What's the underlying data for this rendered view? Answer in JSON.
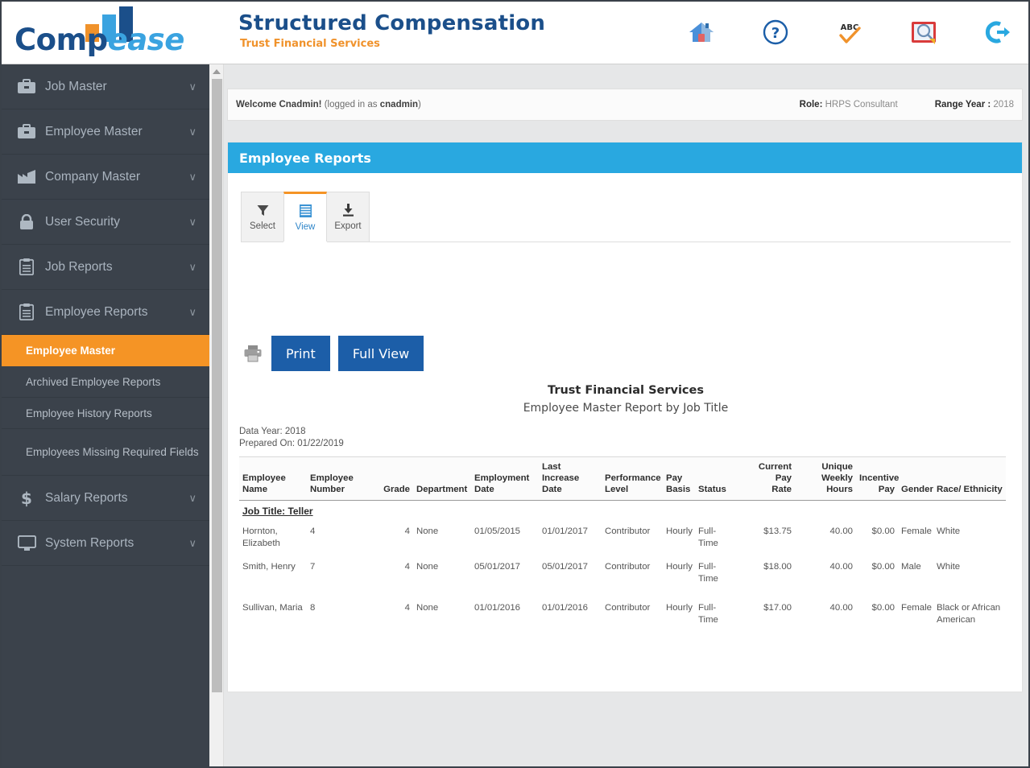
{
  "brand": {
    "logo_comp": "Comp",
    "logo_ease": "ease",
    "app_title": "Structured Compensation",
    "app_subtitle": "Trust Financial Services"
  },
  "header_icons": [
    {
      "name": "home-icon",
      "label": "Home"
    },
    {
      "name": "help-icon",
      "label": "Help"
    },
    {
      "name": "spellcheck-icon",
      "label": "Spell Check"
    },
    {
      "name": "dictionary-search-icon",
      "label": "Lookup"
    },
    {
      "name": "logout-icon",
      "label": "Logout"
    }
  ],
  "sidebar": {
    "items": [
      {
        "label": "Job Master",
        "icon": "briefcase-icon",
        "chevron": "∨"
      },
      {
        "label": "Employee Master",
        "icon": "briefcase-icon",
        "chevron": "∨"
      },
      {
        "label": "Company Master",
        "icon": "factory-icon",
        "chevron": "∨"
      },
      {
        "label": "User Security",
        "icon": "lock-icon",
        "chevron": "∨"
      },
      {
        "label": "Job Reports",
        "icon": "clipboard-icon",
        "chevron": "∨"
      },
      {
        "label": "Employee Reports",
        "icon": "clipboard-icon",
        "chevron": "∨"
      }
    ],
    "sub_items": [
      {
        "label": "Employee Master",
        "active": true
      },
      {
        "label": "Archived Employee Reports",
        "active": false
      },
      {
        "label": "Employee History Reports",
        "active": false
      },
      {
        "label": "Employees Missing Required Fields",
        "active": false
      }
    ],
    "items_after": [
      {
        "label": "Salary Reports",
        "icon": "dollar-icon",
        "chevron": "∨"
      },
      {
        "label": "System Reports",
        "icon": "monitor-icon",
        "chevron": "∨"
      }
    ]
  },
  "welcome": {
    "greeting": "Welcome Cnadmin!",
    "logged_in_prefix": " (logged in as ",
    "username": "cnadmin",
    "logged_in_suffix": ")",
    "role_label": "Role:",
    "role_value": "HRPS Consultant",
    "range_year_label": "Range Year :",
    "range_year_value": "2018"
  },
  "panel": {
    "title": "Employee Reports"
  },
  "tabs": [
    {
      "label": "Select",
      "icon": "funnel-icon",
      "active": false
    },
    {
      "label": "View",
      "icon": "list-icon",
      "active": true
    },
    {
      "label": "Export",
      "icon": "download-icon",
      "active": false
    }
  ],
  "actions": {
    "printer_icon": "printer-icon",
    "print_label": "Print",
    "full_view_label": "Full View"
  },
  "report": {
    "company": "Trust Financial Services",
    "title": "Employee Master Report by Job Title",
    "data_year": "Data Year: 2018",
    "prepared_on": "Prepared On: 01/22/2019",
    "columns": [
      {
        "l1": "Employee",
        "l2": "Name",
        "align": "l"
      },
      {
        "l1": "Employee",
        "l2": "Number",
        "align": "l"
      },
      {
        "l1": "",
        "l2": "Grade",
        "align": "r"
      },
      {
        "l1": "",
        "l2": "Department",
        "align": "l"
      },
      {
        "l1": "Employment",
        "l2": "Date",
        "align": "l"
      },
      {
        "l1": "Last Increase",
        "l2": "Date",
        "align": "l"
      },
      {
        "l1": "Performance",
        "l2": "Level",
        "align": "l"
      },
      {
        "l1": "Pay",
        "l2": "Basis",
        "align": "l"
      },
      {
        "l1": "",
        "l2": "Status",
        "align": "l"
      },
      {
        "l1": "Current Pay",
        "l2": "Rate",
        "align": "r"
      },
      {
        "l1": "Unique Weekly",
        "l2": "Hours",
        "align": "r"
      },
      {
        "l1": "Incentive",
        "l2": "Pay",
        "align": "r"
      },
      {
        "l1": "",
        "l2": "Gender",
        "align": "l"
      },
      {
        "l1": "",
        "l2": "Race/ Ethnicity",
        "align": "l"
      }
    ],
    "group_label": "Job Title: Teller",
    "rows": [
      {
        "name": "Hornton, Elizabeth",
        "number": "4",
        "grade": "4",
        "department": "None",
        "employment_date": "01/05/2015",
        "last_increase_date": "01/01/2017",
        "performance_level": "Contributor",
        "pay_basis": "Hourly",
        "status": "Full-Time",
        "current_pay_rate": "$13.75",
        "unique_weekly_hours": "40.00",
        "incentive_pay": "$0.00",
        "gender": "Female",
        "race_ethnicity": "White"
      },
      {
        "name": "Smith, Henry",
        "number": "7",
        "grade": "4",
        "department": "None",
        "employment_date": "05/01/2017",
        "last_increase_date": "05/01/2017",
        "performance_level": "Contributor",
        "pay_basis": "Hourly",
        "status": "Full-Time",
        "current_pay_rate": "$18.00",
        "unique_weekly_hours": "40.00",
        "incentive_pay": "$0.00",
        "gender": "Male",
        "race_ethnicity": "White"
      },
      {
        "name": "Sullivan, Maria",
        "number": "8",
        "grade": "4",
        "department": "None",
        "employment_date": "01/01/2016",
        "last_increase_date": "01/01/2016",
        "performance_level": "Contributor",
        "pay_basis": "Hourly",
        "status": "Full-Time",
        "current_pay_rate": "$17.00",
        "unique_weekly_hours": "40.00",
        "incentive_pay": "$0.00",
        "gender": "Female",
        "race_ethnicity": "Black or African American"
      }
    ]
  },
  "colors": {
    "brand_blue": "#1b4f8a",
    "brand_orange": "#f0922b",
    "panel_blue": "#29a8e0",
    "sidebar_bg": "#3b424b",
    "active_orange": "#f59425",
    "button_blue": "#1c5ea8"
  }
}
